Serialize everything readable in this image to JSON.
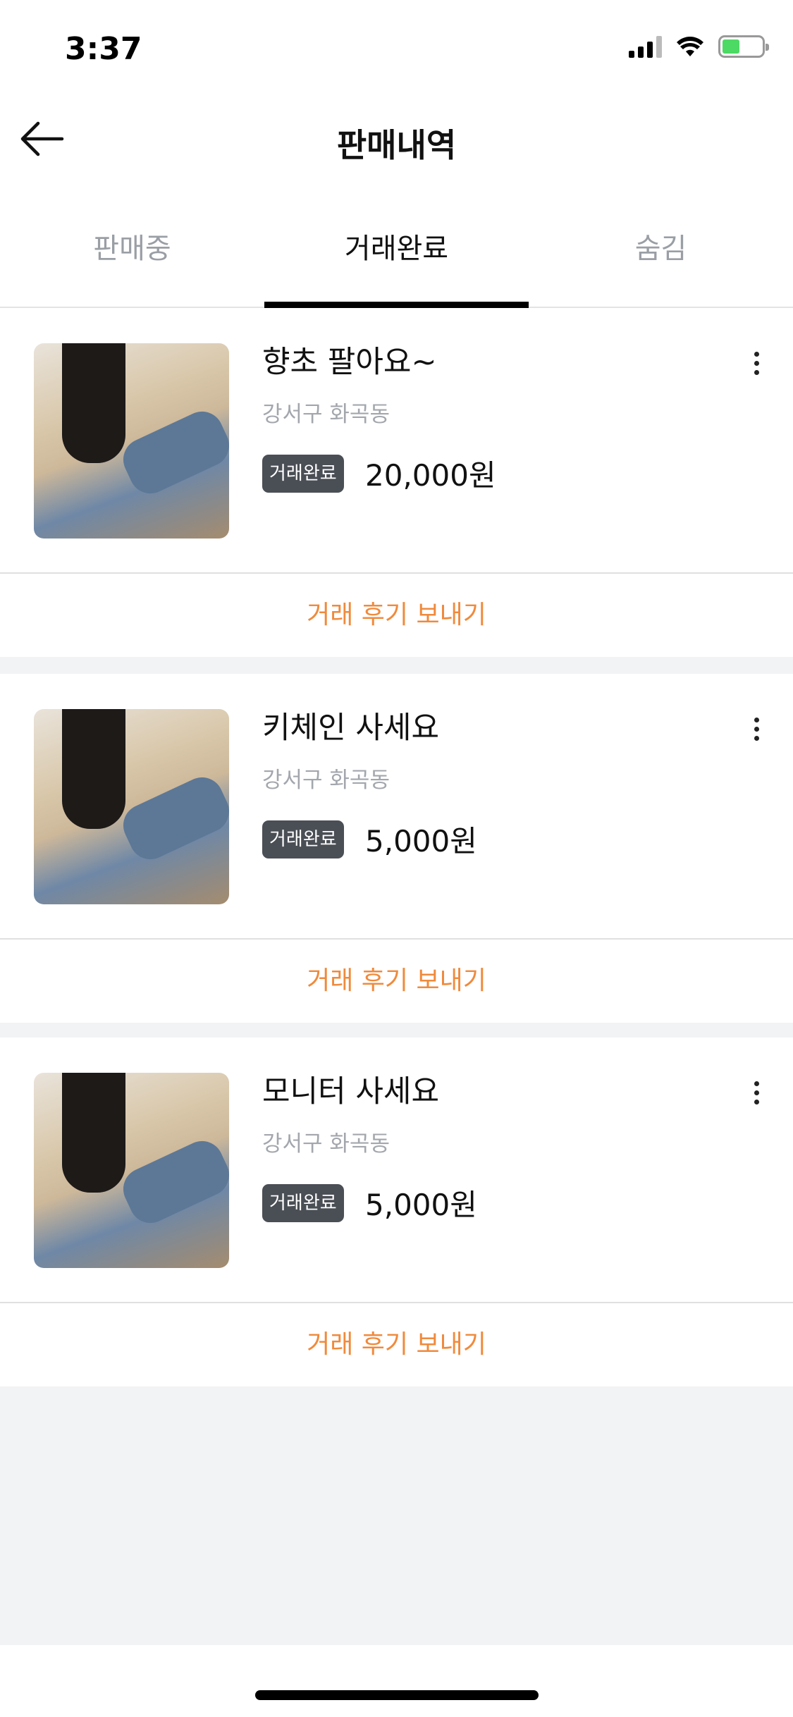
{
  "status_bar": {
    "time": "3:37"
  },
  "header": {
    "title": "판매내역",
    "back_icon": "arrow-left-icon"
  },
  "tabs": [
    {
      "label": "판매중",
      "active": false
    },
    {
      "label": "거래완료",
      "active": true
    },
    {
      "label": "숨김",
      "active": false
    }
  ],
  "colors": {
    "accent": "#f08a3c",
    "badge": "#4a4e55"
  },
  "items": [
    {
      "title": "향초 팔아요~",
      "location": "강서구 화곡동",
      "status": "거래완료",
      "price": "20,000원",
      "action": "거래 후기 보내기"
    },
    {
      "title": "키체인 사세요",
      "location": "강서구 화곡동",
      "status": "거래완료",
      "price": "5,000원",
      "action": "거래 후기 보내기"
    },
    {
      "title": "모니터 사세요",
      "location": "강서구 화곡동",
      "status": "거래완료",
      "price": "5,000원",
      "action": "거래 후기 보내기"
    }
  ]
}
